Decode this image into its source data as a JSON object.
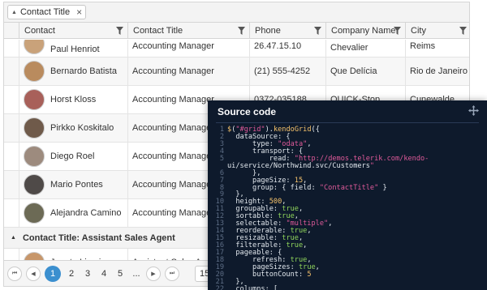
{
  "grid": {
    "group_chip": {
      "label": "Contact Title"
    },
    "columns": [
      {
        "label": "Contact"
      },
      {
        "label": "Contact Title"
      },
      {
        "label": "Phone"
      },
      {
        "label": "Company Name"
      },
      {
        "label": "City"
      }
    ],
    "rows_group1": [
      {
        "contact": "Paul Henriot",
        "title": "Accounting Manager",
        "phone": "26.47.15.10",
        "company": "Chevalier",
        "city": "Reims",
        "avatar_color": "#c9a27a"
      },
      {
        "contact": "Bernardo Batista",
        "title": "Accounting Manager",
        "phone": "(21) 555-4252",
        "company": "Que Delícia",
        "city": "Rio de Janeiro",
        "avatar_color": "#b98b5e"
      },
      {
        "contact": "Horst Kloss",
        "title": "Accounting Manager",
        "phone": "0372-035188",
        "company": "QUICK-Stop",
        "city": "Cunewalde",
        "avatar_color": "#a8605a"
      },
      {
        "contact": "Pirkko Koskitalo",
        "title": "Accounting Manager",
        "phone": "",
        "company": "",
        "city": "",
        "avatar_color": "#6f5a4a"
      },
      {
        "contact": "Diego Roel",
        "title": "Accounting Manager",
        "phone": "",
        "company": "",
        "city": "",
        "avatar_color": "#9d8b7e"
      },
      {
        "contact": "Mario Pontes",
        "title": "Accounting Manager",
        "phone": "",
        "company": "",
        "city": "",
        "avatar_color": "#4f4a48"
      },
      {
        "contact": "Alejandra Camino",
        "title": "Accounting Manager",
        "phone": "",
        "company": "",
        "city": "",
        "avatar_color": "#6c6a55"
      }
    ],
    "group2_label": "Contact Title: Assistant Sales Agent",
    "rows_group2": [
      {
        "contact": "Janete Limeira",
        "title": "Assistant Sales Agent",
        "avatar_color": "#c7966a"
      }
    ]
  },
  "pager": {
    "first": "⏮",
    "prev": "◀",
    "next": "▶",
    "last": "⏭",
    "pages": [
      "1",
      "2",
      "3",
      "4",
      "5",
      "..."
    ],
    "active_page": "1",
    "page_size": "15"
  },
  "code_panel": {
    "title": "Source code",
    "lines": [
      {
        "n": "1",
        "t": "$(\"#grid\").kendoGrid({"
      },
      {
        "n": "2",
        "t": "  dataSource: {"
      },
      {
        "n": "3",
        "t": "      type: \"odata\","
      },
      {
        "n": "4",
        "t": "      transport: {"
      },
      {
        "n": "5",
        "t": "          read: \"http://demos.telerik.com/kendo-"
      },
      {
        "n": "",
        "t": "ui/service/Northwind.svc/Customers\""
      },
      {
        "n": "6",
        "t": "      },"
      },
      {
        "n": "7",
        "t": "      pageSize: 15,"
      },
      {
        "n": "8",
        "t": "      group: { field: \"ContactTitle\" }"
      },
      {
        "n": "9",
        "t": "  },"
      },
      {
        "n": "10",
        "t": "  height: 500,"
      },
      {
        "n": "11",
        "t": "  groupable: true,"
      },
      {
        "n": "12",
        "t": "  sortable: true,"
      },
      {
        "n": "13",
        "t": "  selectable: \"multiple\","
      },
      {
        "n": "14",
        "t": "  reorderable: true,"
      },
      {
        "n": "15",
        "t": "  resizable: true,"
      },
      {
        "n": "16",
        "t": "  filterable: true,"
      },
      {
        "n": "17",
        "t": "  pageable: {"
      },
      {
        "n": "18",
        "t": "      refresh: true,"
      },
      {
        "n": "19",
        "t": "      pageSizes: true,"
      },
      {
        "n": "20",
        "t": "      buttonCount: 5"
      },
      {
        "n": "21",
        "t": "  },"
      },
      {
        "n": "22",
        "t": "  columns: ["
      }
    ]
  },
  "colors": {
    "accent": "#3b8fcf",
    "code_bg": "#0e1a2c",
    "code_string": "#e05a9a",
    "code_keyword": "#8fd45b",
    "code_function": "#f5c26b"
  }
}
